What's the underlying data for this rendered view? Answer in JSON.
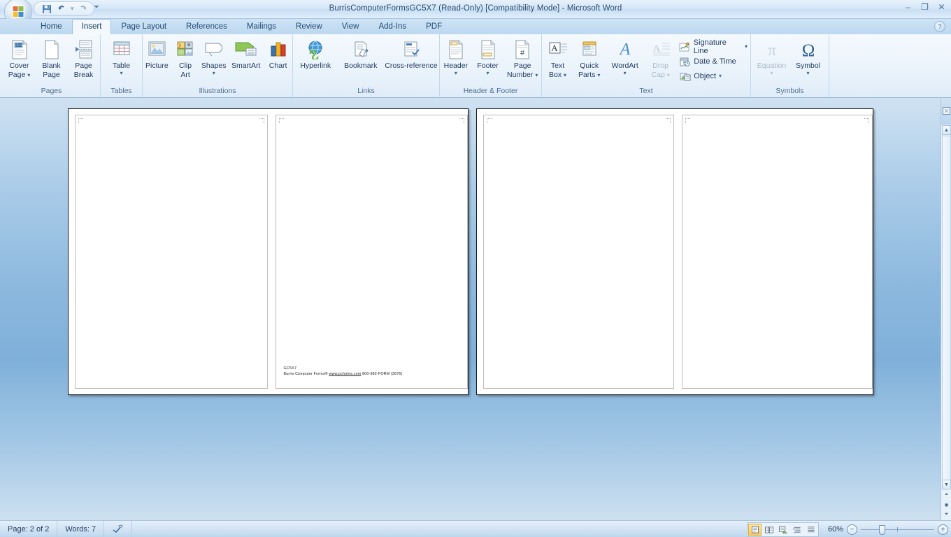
{
  "window": {
    "title": "BurrisComputerFormsGC5X7 (Read-Only) [Compatibility Mode] - Microsoft Word",
    "minimize": "–",
    "maximize": "❐",
    "close": "✕"
  },
  "quick_access": {
    "save_label": "Save",
    "undo_label": "Undo",
    "redo_label": "Redo",
    "customize_label": "Customize Quick Access Toolbar"
  },
  "tabs": [
    {
      "label": "Home",
      "active": false
    },
    {
      "label": "Insert",
      "active": true
    },
    {
      "label": "Page Layout",
      "active": false
    },
    {
      "label": "References",
      "active": false
    },
    {
      "label": "Mailings",
      "active": false
    },
    {
      "label": "Review",
      "active": false
    },
    {
      "label": "View",
      "active": false
    },
    {
      "label": "Add-Ins",
      "active": false
    },
    {
      "label": "PDF",
      "active": false
    }
  ],
  "help": {
    "label": "?"
  },
  "ribbon": {
    "groups": [
      {
        "name": "Pages",
        "label": "Pages",
        "buttons": [
          {
            "label_top": "Cover",
            "label_bottom": "Page",
            "dropdown": true,
            "disabled": false
          },
          {
            "label_top": "Blank",
            "label_bottom": "Page",
            "dropdown": false,
            "disabled": false
          },
          {
            "label_top": "Page",
            "label_bottom": "Break",
            "dropdown": false,
            "disabled": false
          }
        ]
      },
      {
        "name": "Tables",
        "label": "Tables",
        "buttons": [
          {
            "label_top": "Table",
            "label_bottom": "",
            "dropdown": true,
            "disabled": false
          }
        ]
      },
      {
        "name": "Illustrations",
        "label": "Illustrations",
        "buttons": [
          {
            "label_top": "Picture",
            "label_bottom": "",
            "dropdown": false,
            "disabled": false
          },
          {
            "label_top": "Clip",
            "label_bottom": "Art",
            "dropdown": false,
            "disabled": false
          },
          {
            "label_top": "Shapes",
            "label_bottom": "",
            "dropdown": true,
            "disabled": false
          },
          {
            "label_top": "SmartArt",
            "label_bottom": "",
            "dropdown": false,
            "disabled": false
          },
          {
            "label_top": "Chart",
            "label_bottom": "",
            "dropdown": false,
            "disabled": false
          }
        ]
      },
      {
        "name": "Links",
        "label": "Links",
        "buttons": [
          {
            "label_top": "Hyperlink",
            "label_bottom": "",
            "dropdown": false,
            "disabled": false
          },
          {
            "label_top": "Bookmark",
            "label_bottom": "",
            "dropdown": false,
            "disabled": false
          },
          {
            "label_top": "Cross-reference",
            "label_bottom": "",
            "dropdown": false,
            "disabled": false
          }
        ]
      },
      {
        "name": "Header & Footer",
        "label": "Header & Footer",
        "buttons": [
          {
            "label_top": "Header",
            "label_bottom": "",
            "dropdown": true,
            "disabled": false
          },
          {
            "label_top": "Footer",
            "label_bottom": "",
            "dropdown": true,
            "disabled": false
          },
          {
            "label_top": "Page",
            "label_bottom": "Number",
            "dropdown": true,
            "disabled": false
          }
        ]
      },
      {
        "name": "Text",
        "label": "Text",
        "buttons": [
          {
            "label_top": "Text",
            "label_bottom": "Box",
            "dropdown": true,
            "disabled": false
          },
          {
            "label_top": "Quick",
            "label_bottom": "Parts",
            "dropdown": true,
            "disabled": false
          },
          {
            "label_top": "WordArt",
            "label_bottom": "",
            "dropdown": true,
            "disabled": false
          },
          {
            "label_top": "Drop",
            "label_bottom": "Cap",
            "dropdown": true,
            "disabled": true
          }
        ],
        "small_buttons": [
          {
            "label": "Signature Line",
            "dropdown": true
          },
          {
            "label": "Date & Time",
            "dropdown": false
          },
          {
            "label": "Object",
            "dropdown": true
          }
        ]
      },
      {
        "name": "Symbols",
        "label": "Symbols",
        "buttons": [
          {
            "label_top": "Equation",
            "label_bottom": "",
            "dropdown": true,
            "disabled": true
          },
          {
            "label_top": "Symbol",
            "label_bottom": "",
            "dropdown": true,
            "disabled": false
          }
        ]
      }
    ]
  },
  "document": {
    "footer_code": "GC5X7",
    "footer_brand": "Burris Computer Forms®",
    "footer_link": "www.pcforms.com",
    "footer_phone": "800-982-FORM (3676)"
  },
  "status": {
    "page": "Page: 2 of 2",
    "words": "Words: 7",
    "proofing_label": "Proofing errors",
    "zoom_value": "60%",
    "zoom_out": "−",
    "zoom_in": "+",
    "views": [
      {
        "name": "print-layout",
        "selected": true
      },
      {
        "name": "full-screen-reading",
        "selected": false
      },
      {
        "name": "web-layout",
        "selected": false
      },
      {
        "name": "outline",
        "selected": false
      },
      {
        "name": "draft",
        "selected": false
      }
    ]
  },
  "colors": {
    "accent": "#1f3a5f",
    "ribbon_bg": "#eaf3fb",
    "titlebar": "#d4e6f7",
    "doc_bg": "#7fb0d9",
    "selected_view": "#fdca5a"
  }
}
